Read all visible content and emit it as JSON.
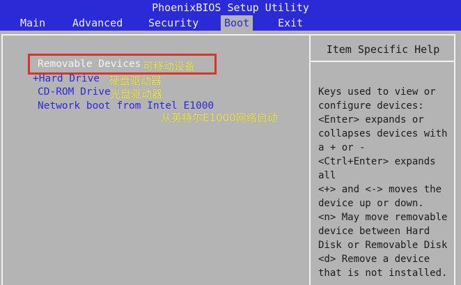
{
  "title": "PhoenixBIOS Setup Utility",
  "menu": {
    "tabs": [
      {
        "label": "Main"
      },
      {
        "label": "Advanced"
      },
      {
        "label": "Security"
      },
      {
        "label": "Boot",
        "active": true
      },
      {
        "label": "Exit"
      }
    ]
  },
  "boot_list": {
    "items": [
      {
        "label": "Removable Devices",
        "annotation": "可移动设备",
        "selected": true
      },
      {
        "label": "+Hard Drive",
        "annotation": "硬盘驱动器"
      },
      {
        "label": "CD-ROM Drive",
        "annotation": "光盘驱动器"
      },
      {
        "label": "Network boot from Intel E1000",
        "annotation": ""
      }
    ],
    "floating_annotation": "从英特尔E1000网络启动"
  },
  "help": {
    "title": "Item Specific Help",
    "lines": [
      "Keys used to view or",
      "configure devices:",
      "<Enter> expands or",
      "collapses devices with",
      "a + or -",
      "<Ctrl+Enter> expands",
      "all",
      "<+> and <-> moves the",
      "device up or down.",
      "<n> May move removable",
      "device between Hard",
      "Disk or Removable Disk",
      "<d> Remove a device",
      "that is not installed."
    ]
  },
  "colors": {
    "bios_blue": "#2a2ad6",
    "bios_gray": "#b4b4b4",
    "annotation_yellow": "#e8e06a",
    "highlight_red": "#d9342b"
  }
}
